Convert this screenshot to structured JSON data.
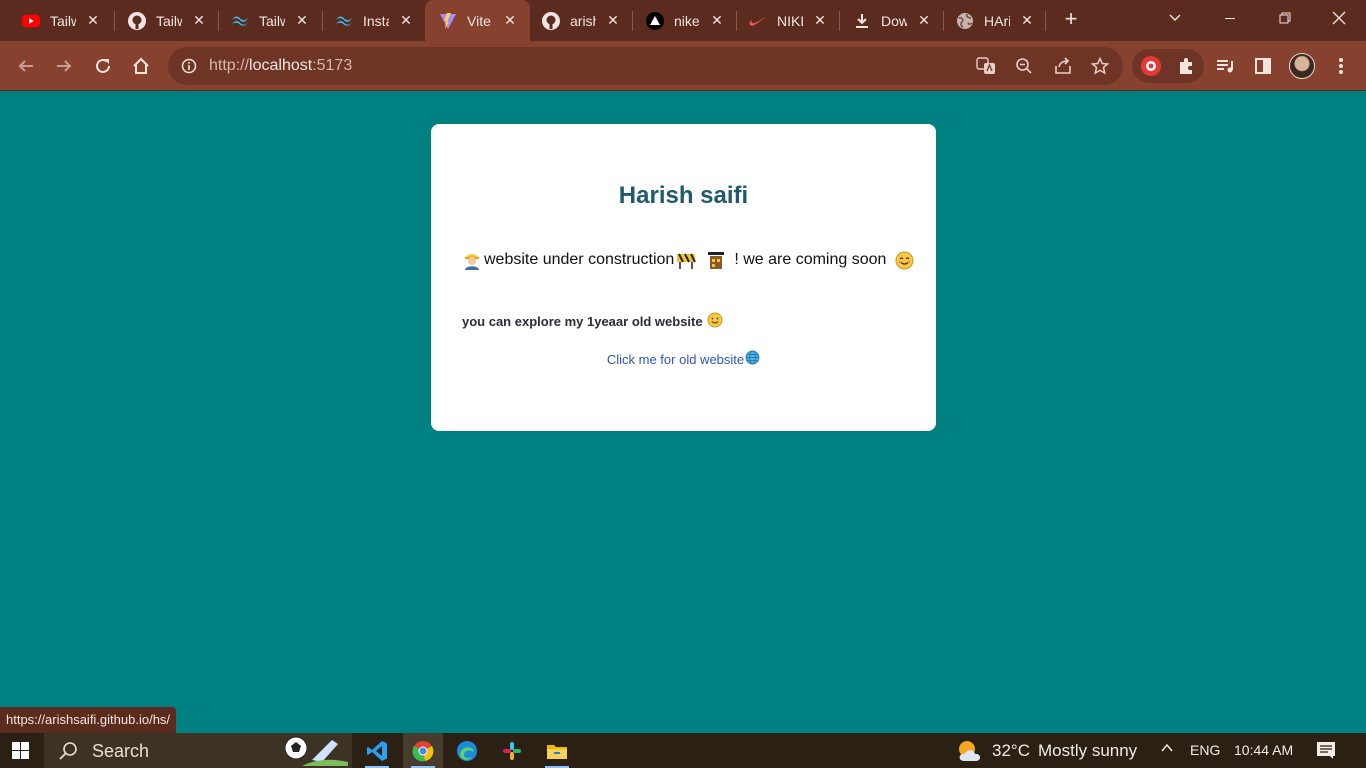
{
  "browser": {
    "tabs": [
      {
        "title": "Tailwind",
        "icon": "youtube-icon"
      },
      {
        "title": "Tailwind",
        "icon": "github-icon"
      },
      {
        "title": "Tailwind",
        "icon": "tailwind-icon"
      },
      {
        "title": "Instagram",
        "icon": "tailwind-icon"
      },
      {
        "title": "Vite",
        "icon": "vite-icon",
        "active": true
      },
      {
        "title": "arish",
        "icon": "github-icon"
      },
      {
        "title": "nike",
        "icon": "triangle-icon"
      },
      {
        "title": "NIKE",
        "icon": "nike-icon"
      },
      {
        "title": "Down",
        "icon": "download-icon"
      },
      {
        "title": "HArish",
        "icon": "globe-icon"
      }
    ],
    "address": {
      "scheme": "http://",
      "host": "localhost",
      "port": ":5173"
    },
    "status_url": "https://arishsaifi.github.io/hs/"
  },
  "page": {
    "title": "Harish saifi",
    "construction_text": "website under construction",
    "coming_soon_text": "! we are coming soon",
    "explore_text": "you can explore my 1yeaar old website",
    "old_site_link": "Click me for old website"
  },
  "taskbar": {
    "search_label": "Search",
    "temperature": "32°C",
    "weather": "Mostly sunny",
    "language": "ENG",
    "time": "10:44 AM"
  },
  "colors": {
    "page_background": "#008080",
    "title": "#1f5a6e",
    "link": "#2b55c9",
    "browser_frame": "#87412f"
  }
}
